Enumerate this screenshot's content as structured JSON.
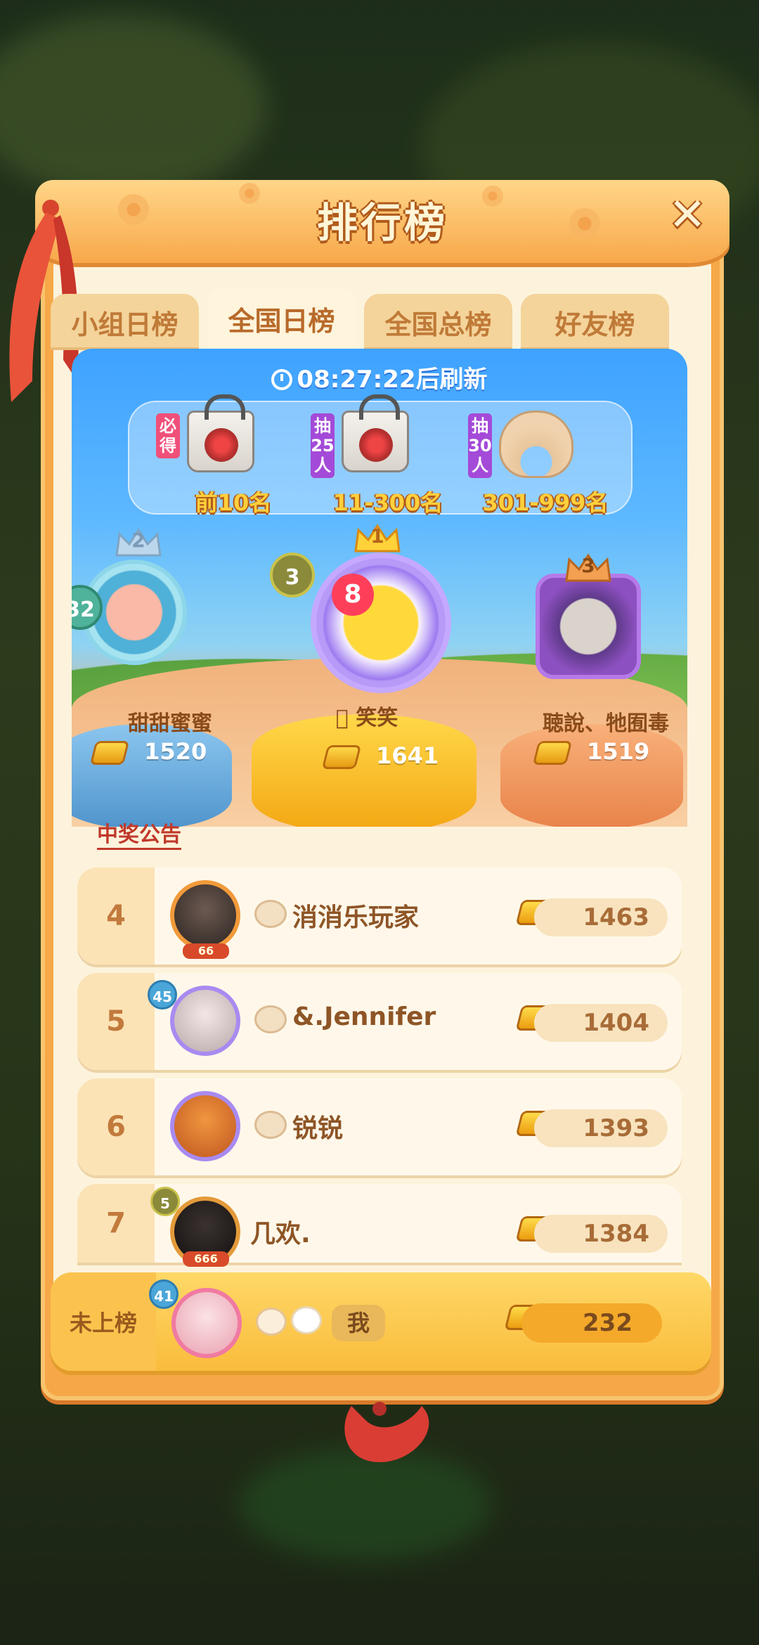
{
  "header": {
    "title": "排行榜",
    "close": "✕"
  },
  "tabs": [
    {
      "label": "小组日榜"
    },
    {
      "label": "全国日榜"
    },
    {
      "label": "全国总榜"
    },
    {
      "label": "好友榜"
    }
  ],
  "refresh": {
    "time": "08:27:22",
    "suffix": "后刷新"
  },
  "prizes": [
    {
      "tag": "必得",
      "label": "前10名"
    },
    {
      "tag": "抽25人",
      "label": "11-300名"
    },
    {
      "tag": "抽30人",
      "label": "301-999名"
    }
  ],
  "podium": {
    "first": {
      "crown": "1",
      "level": "3",
      "badge": "8",
      "name": "\u0000 笑笑",
      "score": "1641"
    },
    "second": {
      "crown": "2",
      "level": "32",
      "name": "甜甜蜜蜜",
      "score": "1520"
    },
    "third": {
      "crown": "3",
      "name": "聴說、牠囿毒",
      "score": "1519"
    }
  },
  "announcement": "中奖公告",
  "rows": [
    {
      "rank": "4",
      "name": "消消乐玩家",
      "score": "1463",
      "frame": "66"
    },
    {
      "rank": "5",
      "level": "45",
      "name": "&.Jennifer",
      "score": "1404"
    },
    {
      "rank": "6",
      "name": "锐锐",
      "score": "1393"
    },
    {
      "rank": "7",
      "level": "5",
      "name": "几欢.",
      "score": "1384",
      "frame": "666"
    }
  ],
  "me": {
    "rank": "未上榜",
    "level": "41",
    "name": "我",
    "score": "232"
  }
}
